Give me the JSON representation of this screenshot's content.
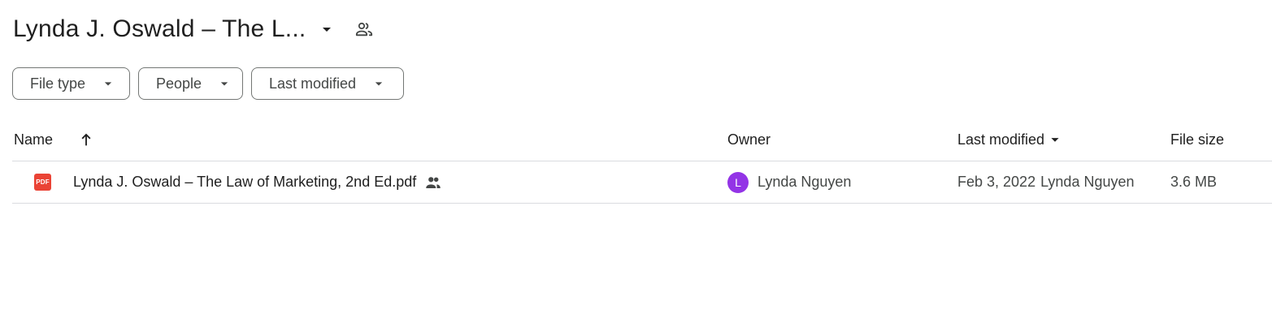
{
  "header": {
    "title": "Lynda J. Oswald – The L...",
    "caret_icon": "arrow-drop-down-icon",
    "shared_icon": "people-outline-icon"
  },
  "filters": [
    {
      "label": "File type"
    },
    {
      "label": "People"
    },
    {
      "label": "Last modified"
    }
  ],
  "table": {
    "columns": {
      "name": "Name",
      "owner": "Owner",
      "last_modified": "Last modified",
      "file_size": "File size"
    },
    "sort": {
      "column": "name",
      "direction": "ascending",
      "icon": "arrow-upward-icon"
    },
    "rows": [
      {
        "file_icon": "PDF",
        "name": "Lynda J. Oswald – The Law of Marketing, 2nd Ed.pdf",
        "shared": true,
        "owner_initial": "L",
        "owner": "Lynda Nguyen",
        "modified_date": "Feb 3, 2022",
        "modified_by": "Lynda Nguyen",
        "size": "3.6 MB"
      }
    ]
  },
  "colors": {
    "pdf_red": "#ea4335",
    "avatar_purple": "#9334e6",
    "border": "#747775",
    "divider": "#dadce0"
  }
}
